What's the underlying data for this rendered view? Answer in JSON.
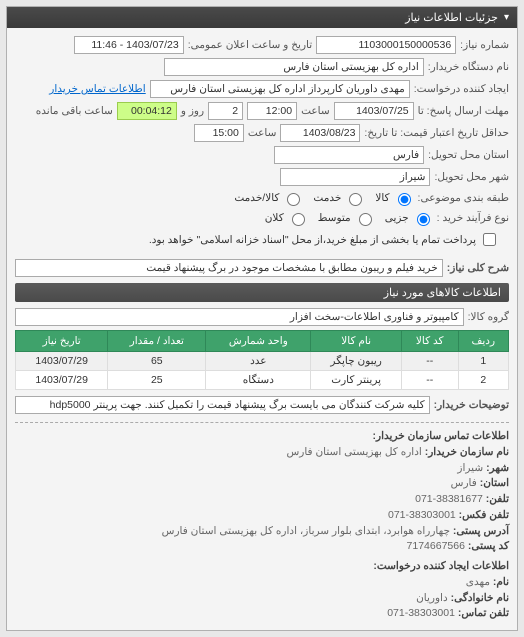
{
  "panel": {
    "title": "جزئیات اطلاعات نیاز"
  },
  "form": {
    "req_no_label": "شماره نیاز:",
    "req_no": "1103000150000536",
    "pub_datetime_label": "تاریخ و ساعت اعلان عمومی:",
    "pub_datetime": "1403/07/23 - 11:46",
    "buyer_org_label": "نام دستگاه خریدار:",
    "buyer_org": "اداره کل بهزیستی استان فارس",
    "requester_label": "ایجاد کننده درخواست:",
    "requester": "مهدی داوریان کارپرداز اداره کل بهزیستی استان فارس",
    "buyer_contact_link": "اطلاعات تماس خریدار",
    "resp_deadline_label": "مهلت ارسال پاسخ: تا",
    "resp_date": "1403/07/25",
    "time_label": "ساعت",
    "resp_time": "12:00",
    "days_remaining": "2",
    "days_remaining_suffix": "روز و",
    "time_remaining": "00:04:12",
    "time_remaining_suffix": "ساعت باقی مانده",
    "credit_until_label": "حداقل تاریخ اعتبار قیمت: تا تاریخ:",
    "credit_date": "1403/08/23",
    "credit_time": "15:00",
    "delivery_prov_label": "استان محل تحویل:",
    "delivery_prov": "فارس",
    "delivery_city_label": "شهر محل تحویل:",
    "delivery_city": "شیراز",
    "cat_label": "طبقه بندی موضوعی:",
    "cat_opts": {
      "goods": "کالا",
      "service": "خدمت",
      "both": "کالا/خدمت"
    },
    "purchase_type_label": "نوع فرآیند خرید :",
    "purchase_opts": {
      "small": "جزیی",
      "medium": "متوسط",
      "large": "کلان"
    },
    "payment_note_label": "پرداخت تمام یا بخشی از مبلغ خرید،از محل \"اسناد خزانه اسلامی\" خواهد بود.",
    "desc_label": "شرح کلی نیاز:",
    "desc": "خرید فیلم و ریبون مطابق با مشخصات موجود در برگ پیشنهاد قیمت",
    "items_section": "اطلاعات کالاهای مورد نیاز",
    "goods_group_label": "گروه کالا:",
    "goods_group": "کامپیوتر و فناوری اطلاعات-سخت افزار",
    "buyer_notes_label": "توضیحات خریدار:",
    "buyer_notes": "کلیه شرکت کنندگان می بایست برگ پیشنهاد قیمت را تکمیل کنند. جهت پرینتر hdp5000"
  },
  "table": {
    "headers": {
      "row": "ردیف",
      "code": "کد کالا",
      "name": "نام کالا",
      "unit": "واحد شمارش",
      "qty": "تعداد / مقدار",
      "date": "تاریخ نیاز"
    },
    "rows": [
      {
        "row": "1",
        "code": "--",
        "name": "ریبون چاپگر",
        "unit": "عدد",
        "qty": "65",
        "date": "1403/07/29"
      },
      {
        "row": "2",
        "code": "--",
        "name": "پرینتر کارت",
        "unit": "دستگاه",
        "qty": "25",
        "date": "1403/07/29"
      }
    ]
  },
  "contact": {
    "section1": "اطلاعات تماس سازمان خریدار:",
    "org_label": "نام سازمان خریدار:",
    "org": "اداره کل بهزیستی استان فارس",
    "city_label": "شهر:",
    "city": "شیراز",
    "prov_label": "استان:",
    "prov": "فارس",
    "tel_label": "تلفن:",
    "tel": "38381677-071",
    "fax_label": "تلفن فکس:",
    "fax": "38303001-071",
    "addr_label": "آدرس پستی:",
    "addr": "چهارراه هوابرد، ابتدای بلوار سرباز، اداره کل بهزیستی استان فارس",
    "postal_label": "کد پستی:",
    "postal": "7174667566",
    "section2": "اطلاعات ایجاد کننده درخواست:",
    "fname_label": "نام:",
    "fname": "مهدی",
    "lname_label": "نام خانوادگی:",
    "lname": "داوریان",
    "phone_label": "تلفن تماس:",
    "phone": "38303001-071"
  }
}
